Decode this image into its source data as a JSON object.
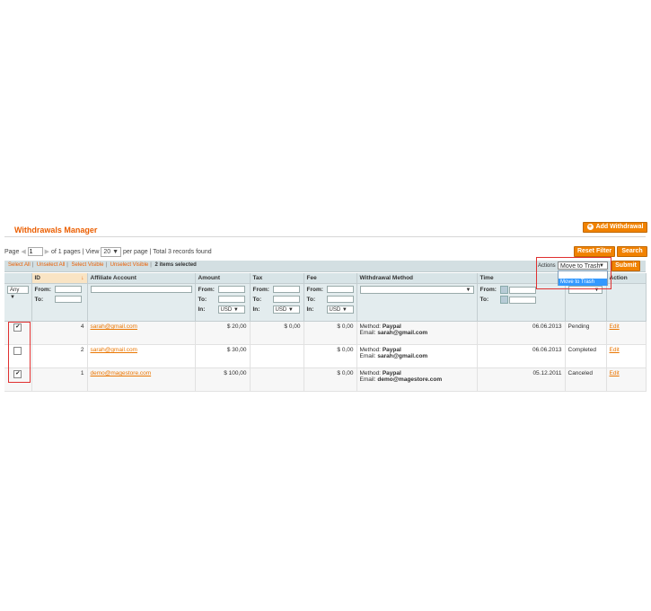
{
  "page": {
    "title": "Withdrawals Manager",
    "add_button": "Add Withdrawal",
    "reset_filter": "Reset Filter",
    "search": "Search"
  },
  "pager": {
    "page_label": "Page",
    "page_value": "1",
    "of_pages": "of 1 pages",
    "view_label": "View",
    "per_page_value": "20",
    "per_page_label": "per page",
    "total": "Total 3 records found"
  },
  "massaction": {
    "select_all": "Select All",
    "unselect_all": "Unselect All",
    "select_visible": "Select Visible",
    "unselect_visible": "Unselect Visible",
    "selected_count": "2 items selected",
    "actions_label": "Actions",
    "selected_action": "Move to Trash",
    "dropdown_option": "Move to Trash",
    "submit": "Submit"
  },
  "columns": [
    "",
    "ID",
    "Affiliate Account",
    "Amount",
    "Tax",
    "Fee",
    "Withdrawal Method",
    "Time",
    "",
    "Action"
  ],
  "filters": {
    "any": "Any",
    "from": "From:",
    "to": "To:",
    "in": "In:",
    "currency": "USD"
  },
  "rows": [
    {
      "checked": true,
      "id": "4",
      "account": "sarah@gmail.com",
      "amount": "$ 20,00",
      "tax": "$ 0,00",
      "fee": "$ 0,00",
      "method_label": "Method:",
      "method": "Paypal",
      "email_label": "Email:",
      "email": "sarah@gmail.com",
      "time": "06.06.2013",
      "status": "Pending",
      "action": "Edit"
    },
    {
      "checked": false,
      "id": "2",
      "account": "sarah@gmail.com",
      "amount": "$ 30,00",
      "tax": "",
      "fee": "$ 0,00",
      "method_label": "Method:",
      "method": "Paypal",
      "email_label": "Email:",
      "email": "sarah@gmail.com",
      "time": "06.06.2013",
      "status": "Completed",
      "action": "Edit"
    },
    {
      "checked": true,
      "id": "1",
      "account": "demo@magestore.com",
      "amount": "$ 100,00",
      "tax": "",
      "fee": "$ 0,00",
      "method_label": "Method:",
      "method": "Paypal",
      "email_label": "Email:",
      "email": "demo@magestore.com",
      "time": "05.12.2011",
      "status": "Canceled",
      "action": "Edit"
    }
  ],
  "colors": {
    "accent": "#eb5e00",
    "button": "#f18200",
    "header_bg": "#d8e4e7",
    "highlight": "#e03030"
  }
}
